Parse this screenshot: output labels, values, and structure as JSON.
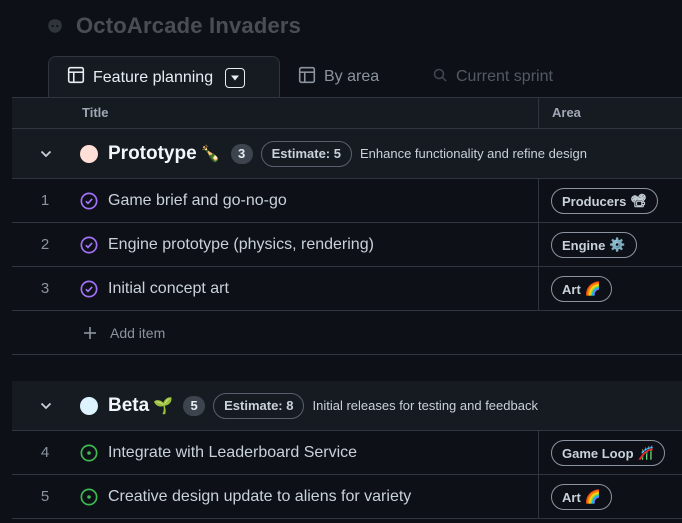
{
  "project": {
    "title": "OctoArcade Invaders"
  },
  "tabs": [
    {
      "label": "Feature planning",
      "active": true,
      "icon": "table-icon"
    },
    {
      "label": "By area",
      "active": false,
      "icon": "table-icon"
    },
    {
      "label": "Current sprint",
      "active": false,
      "icon": "search-icon"
    }
  ],
  "columns": {
    "title": "Title",
    "area": "Area"
  },
  "groups": [
    {
      "name": "Prototype",
      "emoji": "🍾",
      "color": "#ffdfd6",
      "count": "3",
      "estimate": "Estimate: 5",
      "description": "Enhance functionality and refine design",
      "items": [
        {
          "num": "1",
          "title": "Game brief and go-no-go",
          "area": "Producers",
          "area_emoji": "📽",
          "status": "done"
        },
        {
          "num": "2",
          "title": "Engine prototype (physics, rendering)",
          "area": "Engine",
          "area_emoji": "⚙️",
          "status": "done"
        },
        {
          "num": "3",
          "title": "Initial concept art",
          "area": "Art",
          "area_emoji": "🌈",
          "status": "done"
        }
      ],
      "add_label": "Add item"
    },
    {
      "name": "Beta",
      "emoji": "🌱",
      "color": "#ddf4ff",
      "count": "5",
      "estimate": "Estimate: 8",
      "description": "Initial releases for testing and feedback",
      "items": [
        {
          "num": "4",
          "title": "Integrate with Leaderboard Service",
          "area": "Game Loop",
          "area_emoji": "🎢",
          "status": "open"
        },
        {
          "num": "5",
          "title": "Creative design update to aliens for variety",
          "area": "Art",
          "area_emoji": "🌈",
          "status": "open"
        }
      ]
    }
  ],
  "colors": {
    "done": "#a371f7",
    "open": "#3fb950",
    "background": "#0d1117",
    "surface": "#161b22",
    "border": "#30363d"
  }
}
